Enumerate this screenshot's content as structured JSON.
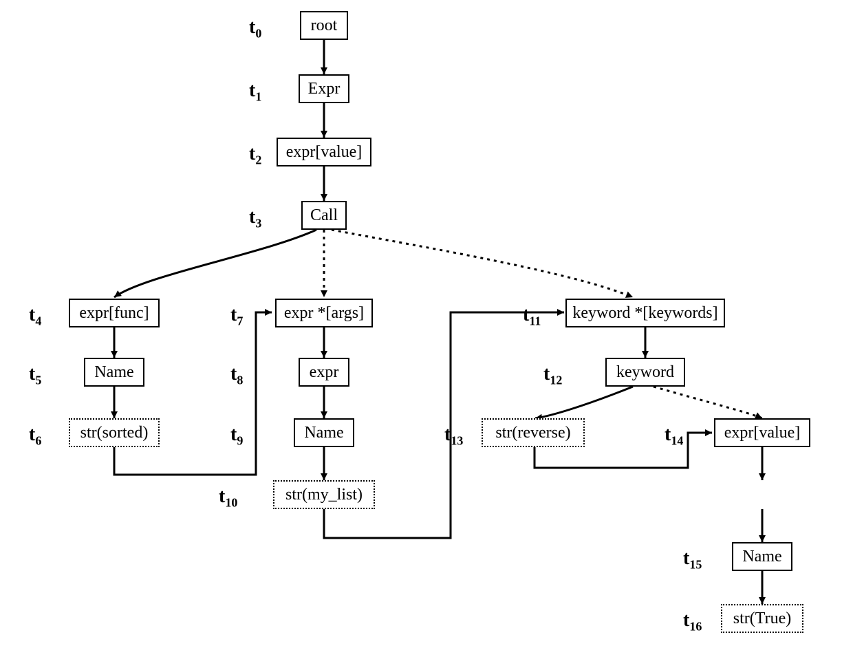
{
  "steps": {
    "t0": "t",
    "t1": "t",
    "t2": "t",
    "t3": "t",
    "t4": "t",
    "t5": "t",
    "t6": "t",
    "t7": "t",
    "t8": "t",
    "t9": "t",
    "t10": "t",
    "t11": "t",
    "t12": "t",
    "t13": "t",
    "t14": "t",
    "t15": "t",
    "t16": "t"
  },
  "subs": {
    "t0": "0",
    "t1": "1",
    "t2": "2",
    "t3": "3",
    "t4": "4",
    "t5": "5",
    "t6": "6",
    "t7": "7",
    "t8": "8",
    "t9": "9",
    "t10": "10",
    "t11": "11",
    "t12": "12",
    "t13": "13",
    "t14": "14",
    "t15": "15",
    "t16": "16"
  },
  "nodes": {
    "root": "root",
    "Expr": "Expr",
    "expr_value_top": "expr[value]",
    "Call": "Call",
    "expr_func": "expr[func]",
    "Name_left": "Name",
    "str_sorted": "str(sorted)",
    "expr_args": "expr *[args]",
    "expr_mid": "expr",
    "Name_mid": "Name",
    "str_mylist": "str(my_list)",
    "keyword_star": "keyword *[keywords]",
    "keyword": "keyword",
    "str_reverse": "str(reverse)",
    "expr_value_right": "expr[value]",
    "Name_right": "Name",
    "str_true": "str(True)"
  }
}
